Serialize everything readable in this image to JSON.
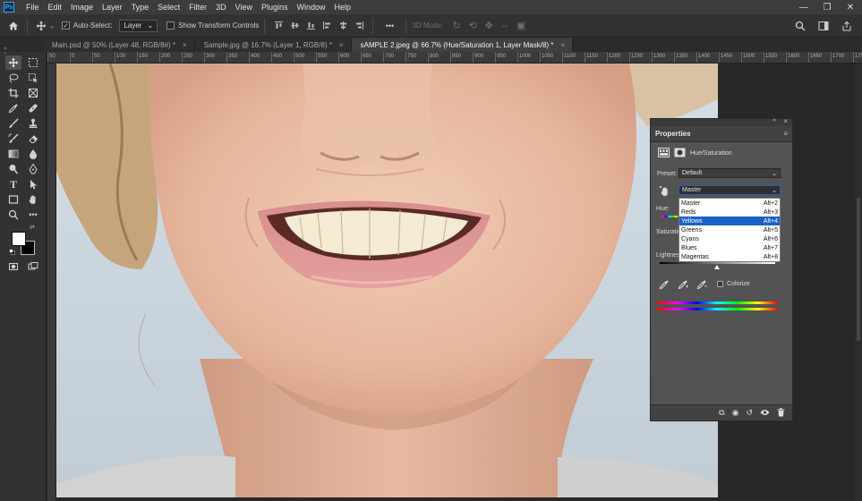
{
  "menubar": {
    "logo": "Ps",
    "items": [
      "File",
      "Edit",
      "Image",
      "Layer",
      "Type",
      "Select",
      "Filter",
      "3D",
      "View",
      "Plugins",
      "Window",
      "Help"
    ],
    "window_controls": [
      "—",
      "❐",
      "✕"
    ]
  },
  "options": {
    "auto_select_label": "Auto-Select:",
    "auto_select_value": "Layer",
    "transform_label": "Show Transform Controls",
    "mode_3d": "3D Mode:",
    "more": "•••"
  },
  "tabs": [
    {
      "label": "Main.psd @ 50% (Layer 48, RGB/8#) *",
      "active": false
    },
    {
      "label": "Sample.jpg @ 16.7% (Layer 1, RGB/8) *",
      "active": false
    },
    {
      "label": "sAMPLE 2.jpeg @ 66.7% (Hue/Saturation 1, Layer Mask/8) *",
      "active": true
    }
  ],
  "ruler": [
    "50",
    "0",
    "50",
    "100",
    "150",
    "200",
    "250",
    "300",
    "350",
    "400",
    "450",
    "500",
    "550",
    "600",
    "650",
    "700",
    "750",
    "800",
    "850",
    "900",
    "950",
    "1000",
    "1050",
    "1100",
    "1150",
    "1200",
    "1250",
    "1300",
    "1350",
    "1400",
    "1450",
    "1500",
    "1550",
    "1600",
    "1650",
    "1700",
    "1750",
    "1800",
    "1850"
  ],
  "properties": {
    "title": "Properties",
    "adjustment_name": "Hue/Saturation",
    "preset_label": "Preset:",
    "preset_value": "Default",
    "channel_value": "Master",
    "hue_label": "Hue:",
    "saturation_label": "Saturation:",
    "lightness_label": "Lightness:",
    "colorize_label": "Colorize",
    "dropdown": [
      {
        "label": "Master",
        "shortcut": "Alt+2"
      },
      {
        "label": "Reds",
        "shortcut": "Alt+3"
      },
      {
        "label": "Yellows",
        "shortcut": "Alt+4"
      },
      {
        "label": "Greens",
        "shortcut": "Alt+5"
      },
      {
        "label": "Cyans",
        "shortcut": "Alt+6"
      },
      {
        "label": "Blues",
        "shortcut": "Alt+7"
      },
      {
        "label": "Magentas",
        "shortcut": "Alt+8"
      }
    ],
    "selected_index": 2
  },
  "colors": {
    "accent": "#1a62c7",
    "foreground_swatch": "#ffffff",
    "background_swatch": "#000000"
  }
}
